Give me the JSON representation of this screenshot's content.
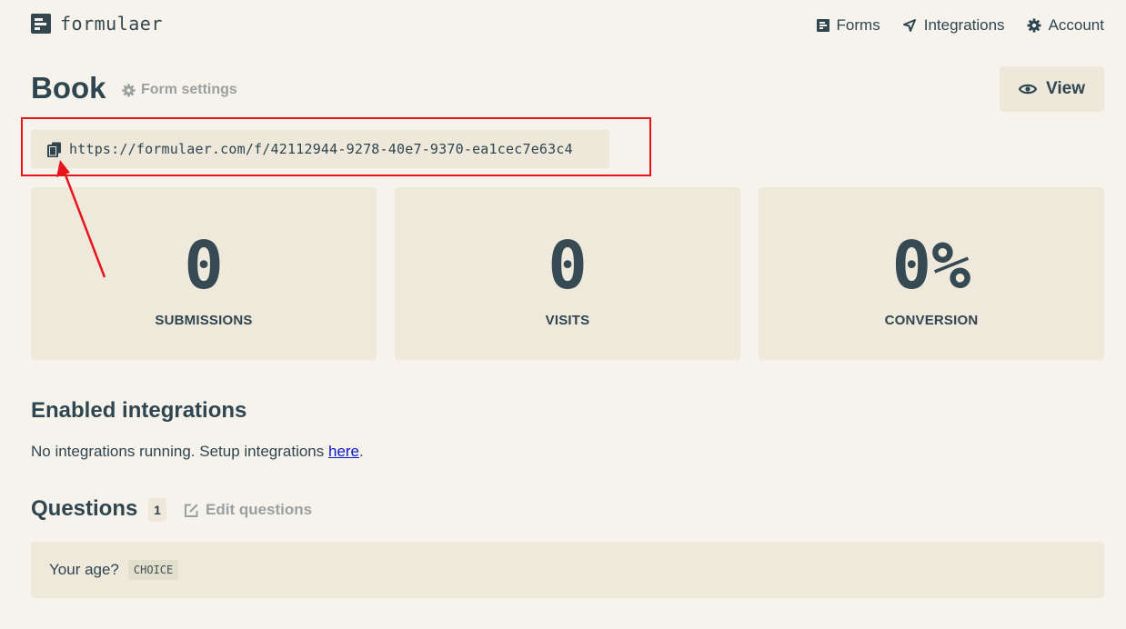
{
  "header": {
    "logo_text": "formulaer",
    "nav": [
      {
        "label": "Forms",
        "icon": "forms-icon"
      },
      {
        "label": "Integrations",
        "icon": "integrations-icon"
      },
      {
        "label": "Account",
        "icon": "gear-icon"
      }
    ]
  },
  "form": {
    "title": "Book",
    "settings_label": "Form settings",
    "view_label": "View",
    "url": "https://formulaer.com/f/42112944-9278-40e7-9370-ea1cec7e63c4"
  },
  "stats": [
    {
      "value": "0",
      "label": "SUBMISSIONS"
    },
    {
      "value": "0",
      "label": "VISITS"
    },
    {
      "value": "0%",
      "label": "CONVERSION"
    }
  ],
  "integrations": {
    "title": "Enabled integrations",
    "text": "No integrations running. Setup integrations ",
    "link": "here",
    "suffix": "."
  },
  "questions": {
    "title": "Questions",
    "count": "1",
    "edit_label": "Edit questions",
    "items": [
      {
        "text": "Your age?",
        "type": "CHOICE"
      }
    ]
  },
  "colors": {
    "background": "#f6f3ec",
    "card": "#efe9dc",
    "text": "#2f4550",
    "muted": "#9aa0a0",
    "annotation": "#e8141c",
    "link": "#0d18c8"
  }
}
